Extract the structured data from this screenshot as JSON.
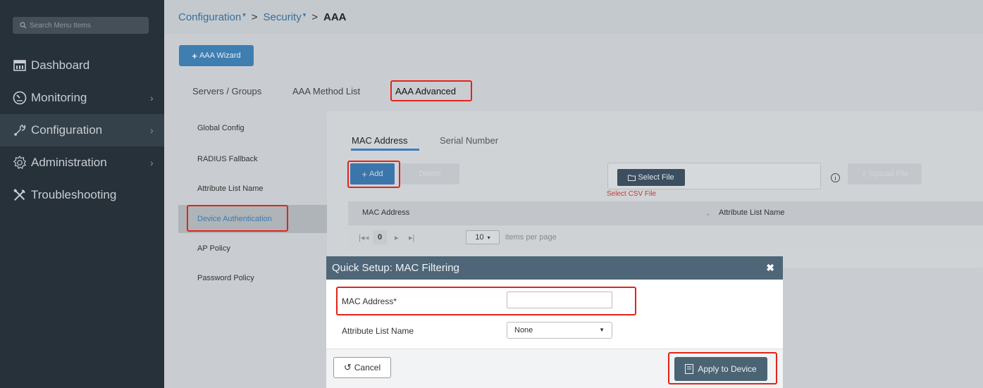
{
  "sidebar": {
    "search_placeholder": "Search Menu Items",
    "items": [
      {
        "label": "Dashboard",
        "icon": "dashboard-icon",
        "chevron": ""
      },
      {
        "label": "Monitoring",
        "icon": "monitoring-icon",
        "chevron": "›"
      },
      {
        "label": "Configuration",
        "icon": "wrench-icon",
        "chevron": "›"
      },
      {
        "label": "Administration",
        "icon": "gear-icon",
        "chevron": "›"
      },
      {
        "label": "Troubleshooting",
        "icon": "tools-icon",
        "chevron": ""
      }
    ]
  },
  "breadcrumb": {
    "items": [
      "Configuration",
      "Security",
      "AAA"
    ],
    "separator": ">"
  },
  "wizard_button": "AAA Wizard",
  "top_tabs": [
    "Servers / Groups",
    "AAA Method List",
    "AAA Advanced"
  ],
  "left_menu": [
    "Global Config",
    "RADIUS Fallback",
    "Attribute List Name",
    "Device Authentication",
    "AP Policy",
    "Password Policy"
  ],
  "panel": {
    "subtabs": [
      "MAC Address",
      "Serial Number"
    ],
    "add_label": "Add",
    "delete_label": "Delete",
    "select_file_label": "Select File",
    "csv_hint": "Select CSV File",
    "upload_label": "Upload File",
    "columns": [
      "MAC Address",
      "Attribute List Name"
    ],
    "pager": {
      "page": "0",
      "per_page": "10",
      "items_per_page_label": "items per page"
    }
  },
  "modal": {
    "title": "Quick Setup: MAC Filtering",
    "mac_label": "MAC Address*",
    "mac_value": "",
    "attr_label": "Attribute List Name",
    "attr_value": "None",
    "cancel_label": "Cancel",
    "apply_label": "Apply to Device"
  },
  "colors": {
    "accent": "#3f7eb1",
    "highlight_border": "#e2241b",
    "sidebar_bg": "#273139"
  }
}
